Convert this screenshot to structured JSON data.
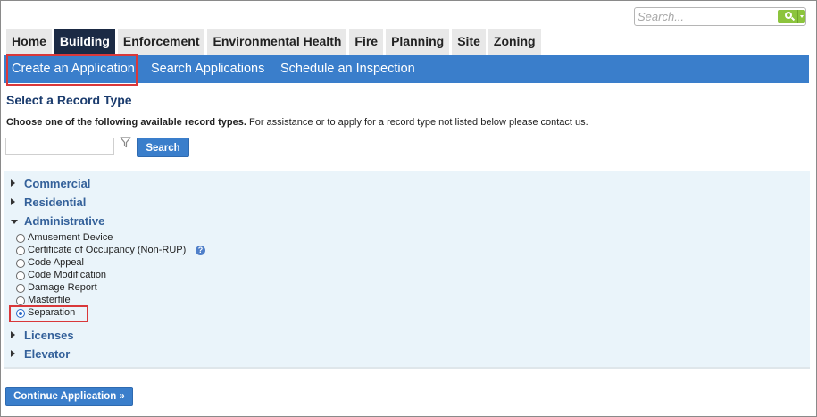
{
  "global_search": {
    "placeholder": "Search..."
  },
  "tabs": [
    {
      "label": "Home",
      "active": false
    },
    {
      "label": "Building",
      "active": true
    },
    {
      "label": "Enforcement",
      "active": false
    },
    {
      "label": "Environmental Health",
      "active": false
    },
    {
      "label": "Fire",
      "active": false
    },
    {
      "label": "Planning",
      "active": false
    },
    {
      "label": "Site",
      "active": false
    },
    {
      "label": "Zoning",
      "active": false
    }
  ],
  "subnav": [
    {
      "label": "Create an Application"
    },
    {
      "label": "Search Applications"
    },
    {
      "label": "Schedule an Inspection"
    }
  ],
  "page": {
    "title": "Select a Record Type",
    "instructions_bold": "Choose one of the following available record types.",
    "instructions_rest": " For assistance or to apply for a record type not listed below please contact us.",
    "search_button": "Search",
    "continue_button": "Continue Application »"
  },
  "categories": [
    {
      "label": "Commercial",
      "expanded": false
    },
    {
      "label": "Residential",
      "expanded": false
    },
    {
      "label": "Administrative",
      "expanded": true
    },
    {
      "label": "Licenses",
      "expanded": false
    },
    {
      "label": "Elevator",
      "expanded": false
    }
  ],
  "records": [
    {
      "label": "Amusement Device",
      "checked": false
    },
    {
      "label": "Certificate of Occupancy (Non-RUP)",
      "checked": false,
      "help": "?"
    },
    {
      "label": "Code Appeal",
      "checked": false
    },
    {
      "label": "Code Modification",
      "checked": false
    },
    {
      "label": "Damage Report",
      "checked": false
    },
    {
      "label": "Masterfile",
      "checked": false
    },
    {
      "label": "Separation",
      "checked": true
    }
  ],
  "colors": {
    "accent_blue": "#3a7ecb",
    "active_tab": "#1b2a44",
    "highlight_red": "#d9383a",
    "panel_bg": "#eaf4fa"
  }
}
